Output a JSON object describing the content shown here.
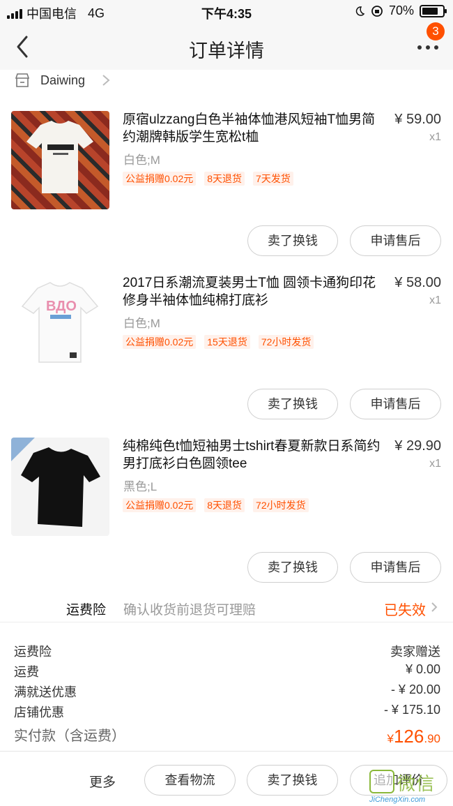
{
  "status_bar": {
    "carrier": "中国电信",
    "network": "4G",
    "time": "下午4:35",
    "battery": "70%"
  },
  "nav": {
    "title": "订单详情",
    "badge_count": "3"
  },
  "shop": {
    "name": "Daiwing"
  },
  "items": [
    {
      "title": "原宿ulzzang白色半袖体恤港风短袖T恤男简约潮牌韩版学生宽松t桖",
      "price": "¥ 59.00",
      "qty": "x1",
      "sku": "白色;M",
      "tags": [
        "公益捐赠0.02元",
        "8天退货",
        "7天发货"
      ],
      "sell_label": "卖了换钱",
      "after_label": "申请售后"
    },
    {
      "title": "2017日系潮流夏装男士T恤 圆领卡通狗印花修身半袖体恤纯棉打底衫",
      "price": "¥ 58.00",
      "qty": "x1",
      "sku": "白色;M",
      "tags": [
        "公益捐赠0.02元",
        "15天退货",
        "72小时发货"
      ],
      "sell_label": "卖了换钱",
      "after_label": "申请售后"
    },
    {
      "title": "纯棉纯色t恤短袖男士tshirt春夏新款日系简约男打底衫白色圆领tee",
      "price": "¥ 29.90",
      "qty": "x1",
      "sku": "黑色;L",
      "tags": [
        "公益捐赠0.02元",
        "8天退货",
        "72小时发货"
      ],
      "sell_label": "卖了换钱",
      "after_label": "申请售后"
    }
  ],
  "shipping_insurance": {
    "label": "运费险",
    "desc": "确认收货前退货可理赔",
    "status": "已失效"
  },
  "summary": {
    "rows": [
      {
        "label": "运费险",
        "value": "卖家赠送"
      },
      {
        "label": "运费",
        "value": "¥ 0.00"
      },
      {
        "label": "满就送优惠",
        "value": "- ¥ 20.00"
      },
      {
        "label": "店铺优惠",
        "value": "- ¥ 175.10"
      }
    ],
    "total_label": "实付款（含运费）",
    "total_currency": "¥",
    "total_int": "126",
    "total_dec": ".90"
  },
  "bottom_bar": {
    "more": "更多",
    "logistics": "查看物流",
    "sell": "卖了换钱",
    "review": "追加评价"
  },
  "watermark": {
    "cn": "微信",
    "en": "JiChengXin.com"
  },
  "colors": {
    "accent": "#ff5000",
    "tag_bg": "#fff1eb"
  }
}
